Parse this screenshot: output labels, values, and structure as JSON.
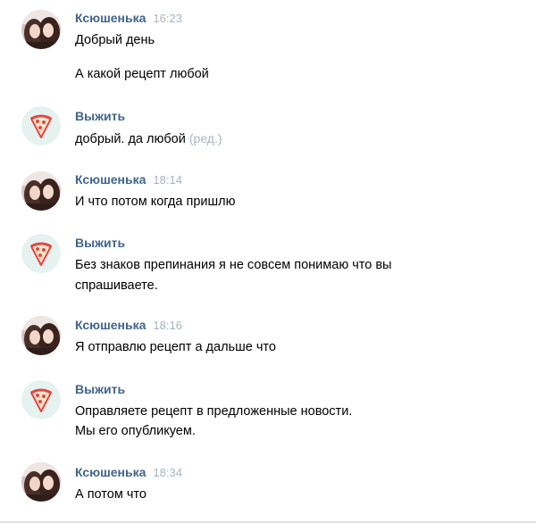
{
  "messages": [
    {
      "author": "Ксюшенька",
      "time": "16:23",
      "avatar": "girls-photo-avatar",
      "lines": [
        "Добрый день",
        "А какой рецепт любой"
      ]
    },
    {
      "author": "Выжить",
      "time": "",
      "avatar": "pizza-icon",
      "lines": [
        "добрый. да любой"
      ],
      "edited_label": "(ред.)"
    },
    {
      "author": "Ксюшенька",
      "time": "18:14",
      "avatar": "girls-photo-avatar",
      "lines": [
        "И что потом когда пришлю"
      ]
    },
    {
      "author": "Выжить",
      "time": "",
      "avatar": "pizza-icon",
      "lines": [
        "Без знаков препинания я не совсем понимаю что вы",
        "спрашиваете."
      ]
    },
    {
      "author": "Ксюшенька",
      "time": "18:16",
      "avatar": "girls-photo-avatar",
      "lines": [
        "Я отправлю рецепт а дальше что"
      ]
    },
    {
      "author": "Выжить",
      "time": "",
      "avatar": "pizza-icon",
      "lines": [
        "Оправляете рецепт в предложенные новости.",
        "Мы его опубликуем."
      ]
    },
    {
      "author": "Ксюшенька",
      "time": "18:34",
      "avatar": "girls-photo-avatar",
      "lines": [
        "А потом что"
      ]
    }
  ],
  "colors": {
    "author": "#42648b",
    "time": "#a8b3bf",
    "pizza_bg": "#e6f2f0",
    "pizza_red": "#e64646"
  }
}
